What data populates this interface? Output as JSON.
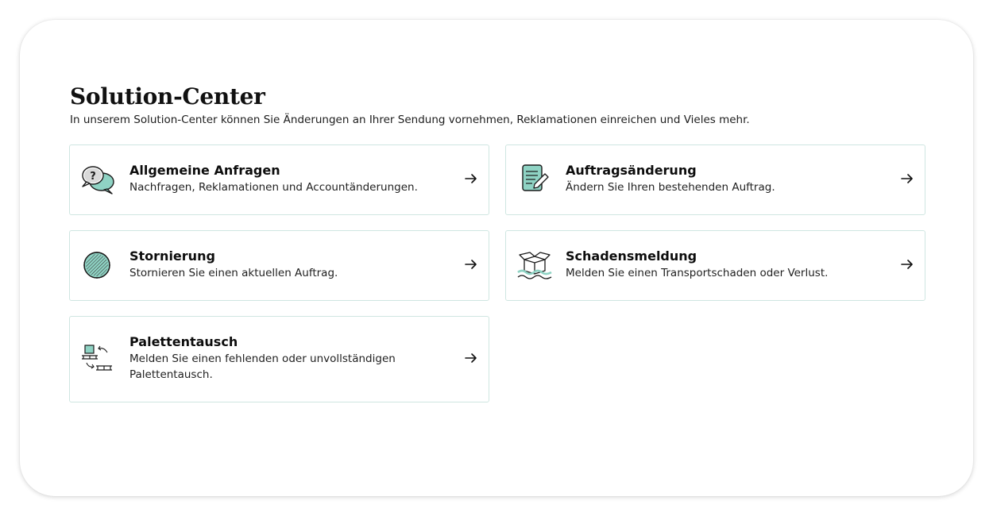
{
  "header": {
    "title": "Solution-Center",
    "subtitle": "In unserem Solution-Center können Sie Änderungen an Ihrer Sendung vornehmen, Reklamationen einreichen und Vieles mehr."
  },
  "colors": {
    "accent": "#8fd3c4",
    "card_border": "#cfe6e1",
    "text": "#111111"
  },
  "cards": [
    {
      "title": "Allgemeine Anfragen",
      "description": "Nachfragen, Reklamationen und Accountänderungen.",
      "icon": "speech-bubbles-icon"
    },
    {
      "title": "Auftragsänderung",
      "description": "Ändern Sie Ihren bestehenden Auftrag.",
      "icon": "document-edit-icon"
    },
    {
      "title": "Stornierung",
      "description": "Stornieren Sie einen aktuellen Auftrag.",
      "icon": "cancel-ball-icon"
    },
    {
      "title": "Schadensmeldung",
      "description": "Melden Sie einen Transportschaden oder Verlust.",
      "icon": "damaged-box-icon"
    },
    {
      "title": "Palettentausch",
      "description": "Melden Sie einen fehlenden oder unvollständigen Palettentausch.",
      "icon": "pallet-exchange-icon"
    }
  ]
}
